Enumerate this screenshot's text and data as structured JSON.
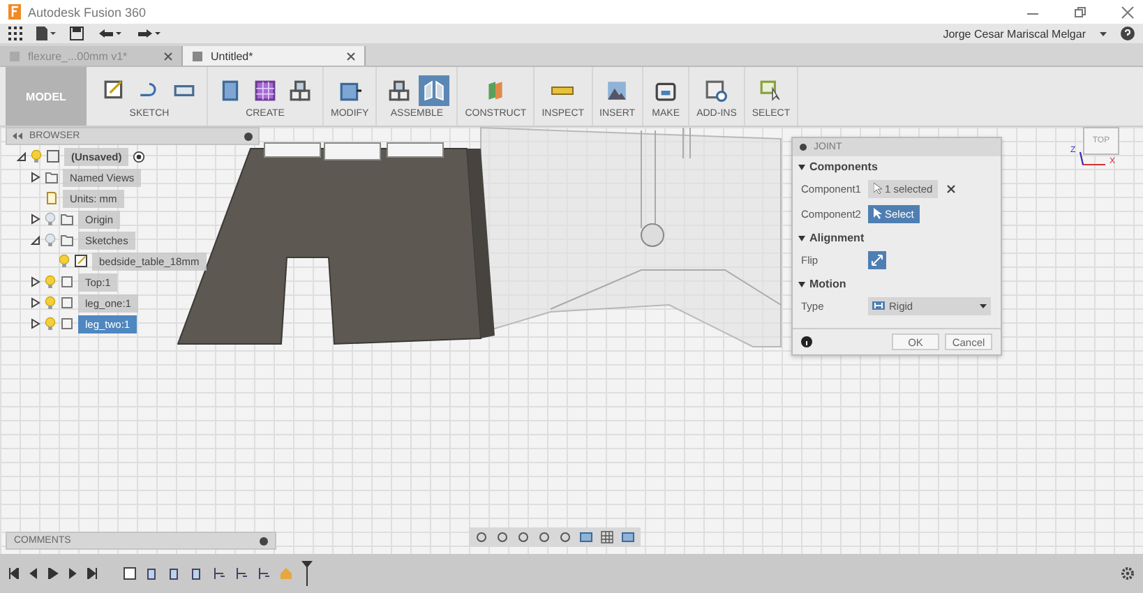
{
  "window": {
    "title": "Autodesk Fusion 360"
  },
  "user": {
    "name": "Jorge Cesar Mariscal Melgar"
  },
  "tabs": [
    {
      "label": "flexure_...00mm v1*",
      "selected": false
    },
    {
      "label": "Untitled*",
      "selected": true
    }
  ],
  "workspace": {
    "label": "MODEL"
  },
  "ribbon": [
    {
      "label": "SKETCH",
      "tools": [
        {
          "kind": "sketch",
          "selected": false
        },
        {
          "kind": "line",
          "selected": false
        },
        {
          "kind": "rect",
          "selected": false
        }
      ]
    },
    {
      "label": "CREATE",
      "tools": [
        {
          "kind": "box",
          "selected": false
        },
        {
          "kind": "pattern",
          "selected": false
        },
        {
          "kind": "component",
          "selected": false
        }
      ]
    },
    {
      "label": "MODIFY",
      "tools": [
        {
          "kind": "press",
          "selected": false
        }
      ]
    },
    {
      "label": "ASSEMBLE",
      "tools": [
        {
          "kind": "component",
          "selected": false
        },
        {
          "kind": "joint",
          "selected": true
        }
      ]
    },
    {
      "label": "CONSTRUCT",
      "tools": [
        {
          "kind": "plane",
          "selected": false
        }
      ]
    },
    {
      "label": "INSPECT",
      "tools": [
        {
          "kind": "measure",
          "selected": false
        }
      ]
    },
    {
      "label": "INSERT",
      "tools": [
        {
          "kind": "image",
          "selected": false
        }
      ]
    },
    {
      "label": "MAKE",
      "tools": [
        {
          "kind": "print",
          "selected": false
        }
      ]
    },
    {
      "label": "ADD-INS",
      "tools": [
        {
          "kind": "script",
          "selected": false
        }
      ]
    },
    {
      "label": "SELECT",
      "tools": [
        {
          "kind": "select",
          "selected": false
        }
      ]
    }
  ],
  "browser": {
    "title": "BROWSER",
    "tree": [
      {
        "label": "(Unsaved)",
        "kind": "root",
        "visible": true,
        "expanded": true,
        "selected": false,
        "children": [
          {
            "label": "Named Views",
            "kind": "folder",
            "expanded": false,
            "selected": false
          },
          {
            "label": "Units: mm",
            "kind": "units",
            "selected": false
          },
          {
            "label": "Origin",
            "kind": "folder",
            "visible": false,
            "expanded": false,
            "selected": false
          },
          {
            "label": "Sketches",
            "kind": "folder",
            "visible": false,
            "expanded": true,
            "selected": false,
            "children": [
              {
                "label": "bedside_table_18mm",
                "kind": "sketch",
                "visible": true,
                "selected": false
              }
            ]
          },
          {
            "label": "Top:1",
            "kind": "body",
            "visible": true,
            "expanded": false,
            "selected": false
          },
          {
            "label": "leg_one:1",
            "kind": "body",
            "visible": true,
            "expanded": false,
            "selected": false
          },
          {
            "label": "leg_two:1",
            "kind": "body",
            "visible": true,
            "expanded": false,
            "selected": true
          }
        ]
      }
    ]
  },
  "joint": {
    "title": "JOINT",
    "sections": [
      {
        "title": "Components",
        "rows": [
          {
            "label": "Component1",
            "kind": "chip",
            "value": "1 selected"
          },
          {
            "label": "Component2",
            "kind": "select",
            "value": "Select"
          }
        ]
      },
      {
        "title": "Alignment",
        "rows": [
          {
            "label": "Flip",
            "kind": "flip"
          }
        ]
      },
      {
        "title": "Motion",
        "rows": [
          {
            "label": "Type",
            "kind": "dropdown",
            "value": "Rigid"
          }
        ]
      }
    ],
    "buttons": [
      "OK",
      "Cancel"
    ]
  },
  "viewcube": {
    "face": "TOP",
    "axes": [
      "Z",
      "X"
    ]
  },
  "comments": {
    "title": "COMMENTS"
  }
}
